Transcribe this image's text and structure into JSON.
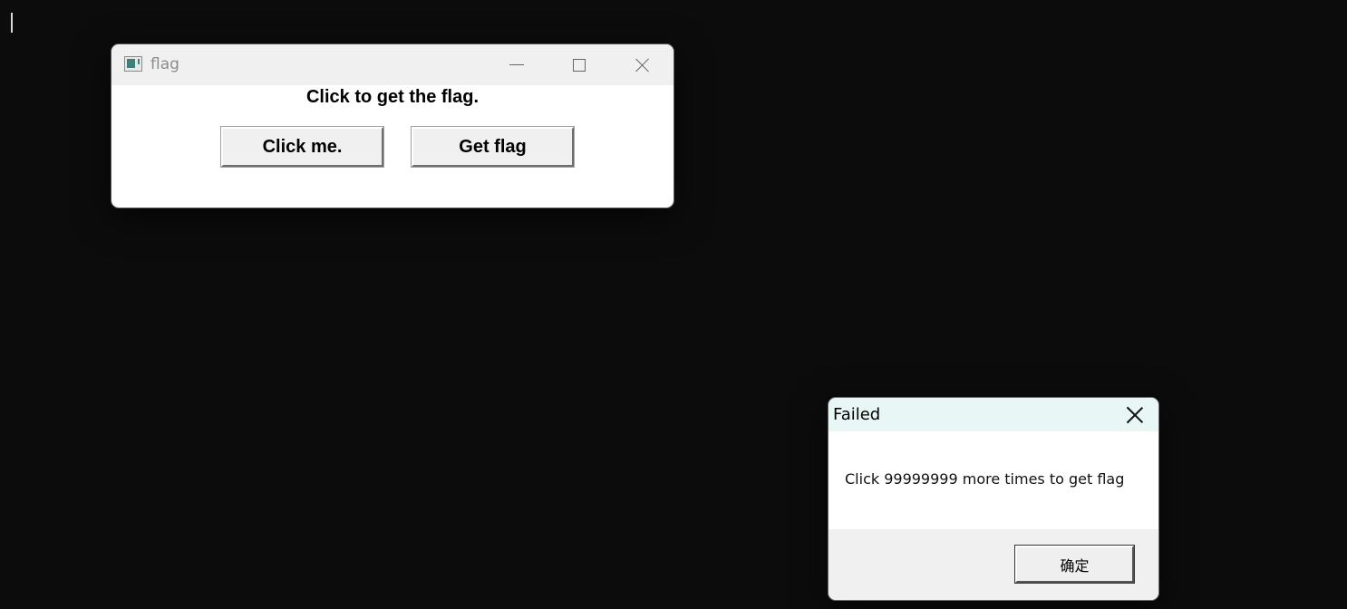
{
  "flag_window": {
    "title": "flag",
    "heading": "Click to get the flag.",
    "click_button_label": "Click me.",
    "get_flag_button_label": "Get flag"
  },
  "message_box": {
    "title": "Failed",
    "message": "Click 99999999 more times to get flag",
    "ok_label": "确定"
  },
  "colors": {
    "desktop": "#0c0c0c",
    "titlebar": "#f0f0f0",
    "msg_titlebar": "#e8f6f6",
    "icon_accent": "#3e7f7a"
  }
}
